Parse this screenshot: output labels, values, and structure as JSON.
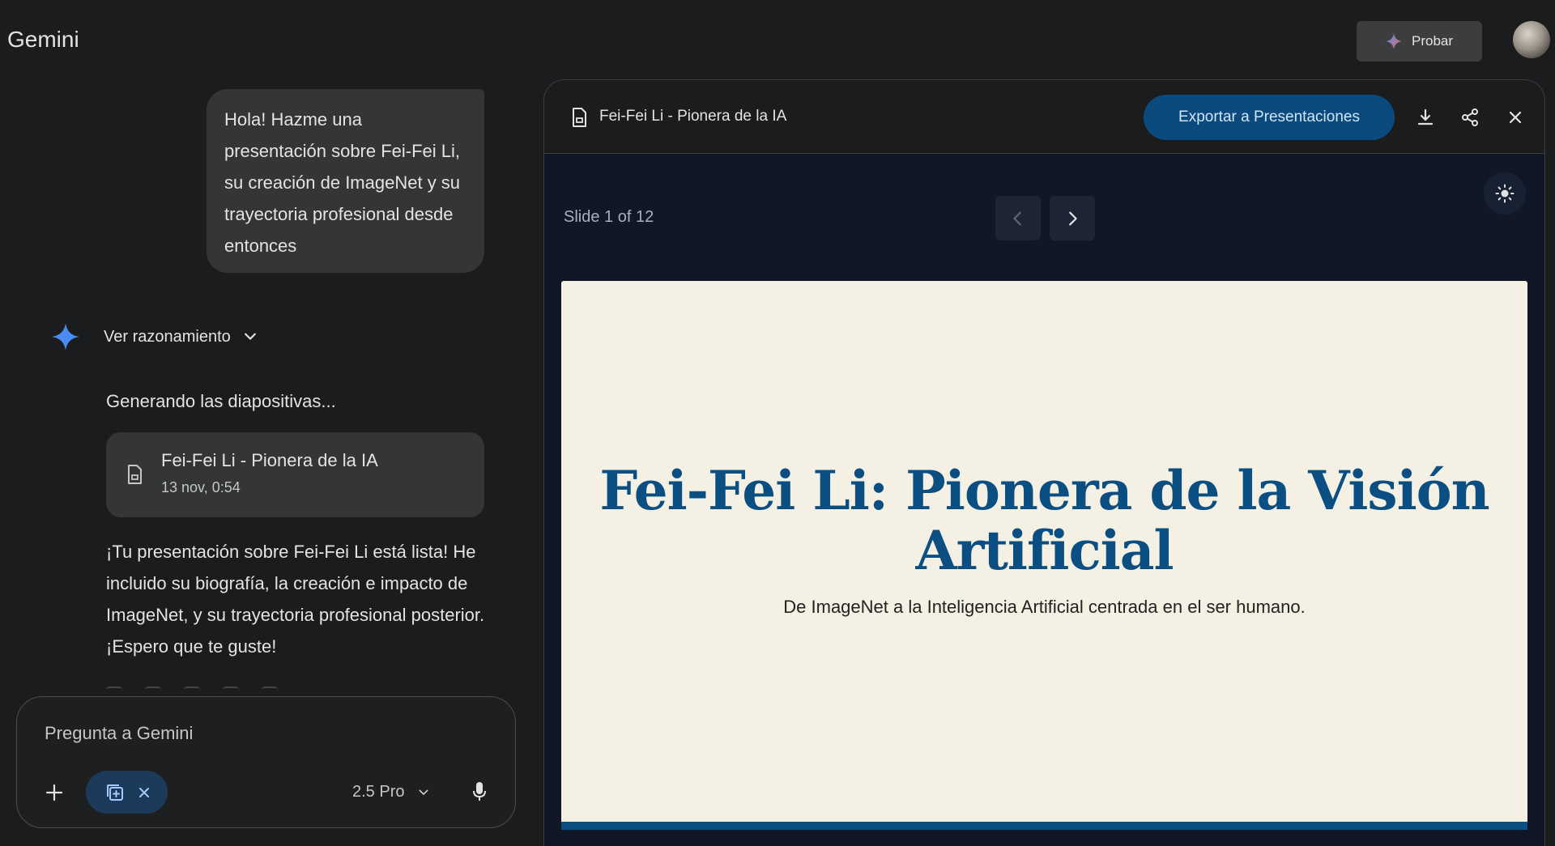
{
  "app": {
    "title": "Gemini"
  },
  "header": {
    "try_label": "Probar"
  },
  "chat": {
    "user_message": "Hola! Hazme una presentación sobre Fei-Fei Li, su creación de ImageNet y su trayectoria profesional desde entonces",
    "reasoning_label": "Ver razonamiento",
    "generating_text": "Generando las diapositivas...",
    "doc_card": {
      "title": "Fei-Fei Li - Pionera de la IA",
      "date": "13 nov, 0:54"
    },
    "response_text": "¡Tu presentación sobre Fei-Fei Li está lista! He incluido su biografía, la creación e impacto de ImageNet, y su trayectoria profesional posterior. ¡Espero que te guste!"
  },
  "input": {
    "placeholder": "Pregunta a Gemini",
    "model": "2.5 Pro"
  },
  "panel": {
    "title": "Fei-Fei Li - Pionera de la IA",
    "export_label": "Exportar a Presentaciones",
    "slide_counter": "Slide 1 of 12"
  },
  "slide": {
    "title": "Fei-Fei Li: Pionera de la Visión Artificial",
    "subtitle": "De ImageNet a la Inteligencia Artificial centrada en el ser humano."
  },
  "colors": {
    "accent": "#0b4f82",
    "export_button": "#0b4a7c",
    "slide_background": "#f4f0e3"
  }
}
